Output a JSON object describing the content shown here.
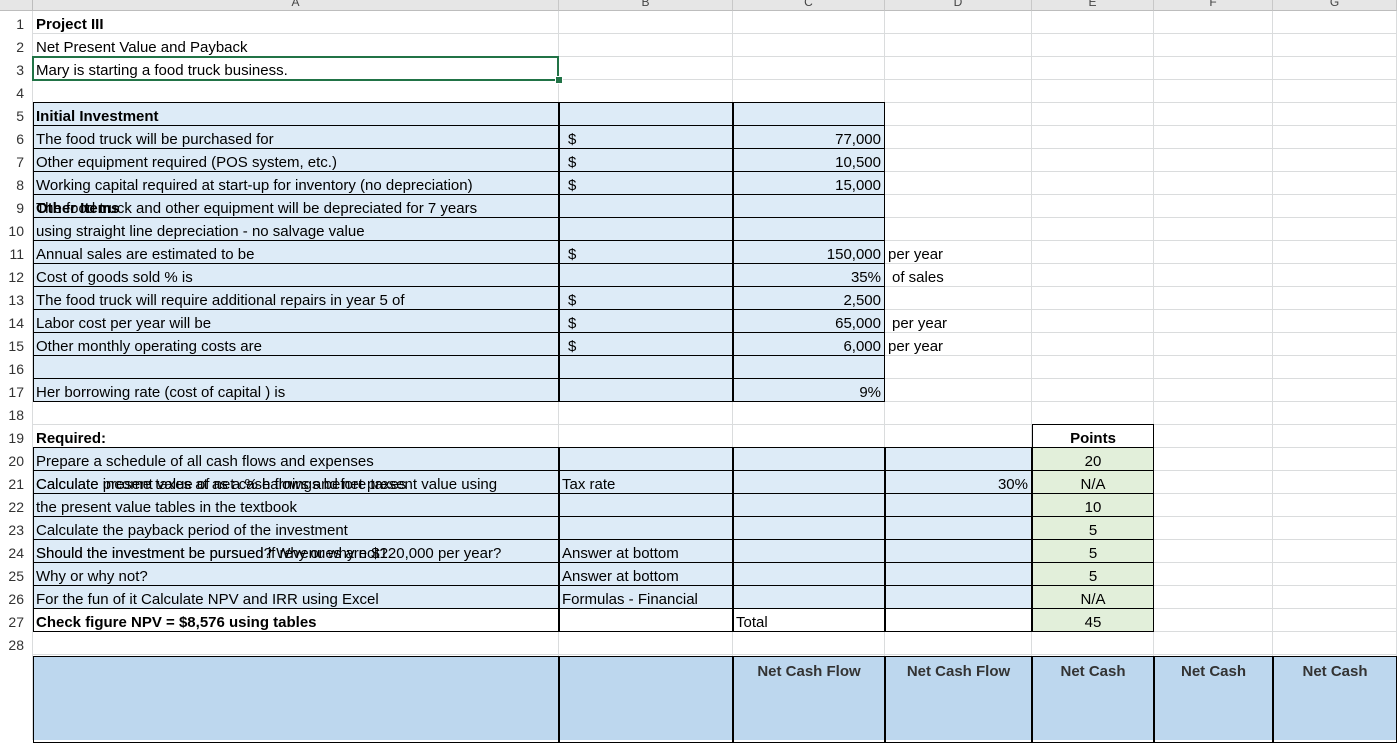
{
  "columns": [
    {
      "letter": "A"
    },
    {
      "letter": "B"
    },
    {
      "letter": "C"
    },
    {
      "letter": "D"
    },
    {
      "letter": "E"
    },
    {
      "letter": "F"
    },
    {
      "letter": "G"
    }
  ],
  "row_numbers": [
    "1",
    "2",
    "3",
    "4",
    "5",
    "6",
    "7",
    "8",
    "9",
    "10",
    "11",
    "12",
    "13",
    "14",
    "15",
    "16",
    "17",
    "18",
    "19",
    "20",
    "21",
    "22",
    "23",
    "24",
    "25",
    "26",
    "27",
    "28"
  ],
  "cells": {
    "r1": {
      "a": "Project III"
    },
    "r2": {
      "a": "Net Present Value and Payback"
    },
    "r3": {
      "a": "Mary is starting a food truck business."
    },
    "r5": {
      "a": "Initial Investment"
    },
    "r6": {
      "a": "The food truck will be purchased for",
      "b": "$",
      "c": "77,000"
    },
    "r7": {
      "a": "Other equipment required (POS system, etc.)",
      "b": "$",
      "c": "10,500"
    },
    "r8": {
      "a": "Working capital required at start-up for inventory (no depreciation)",
      "b": "$",
      "c": "15,000"
    },
    "r9": {
      "a": "Other Items"
    },
    "r10": {
      "a1": "The food truck and other equipment will be depreciated for 7 years",
      "a2": "using straight line depreciation  - no salvage value"
    },
    "r11": {
      "a": "Annual sales are estimated to be",
      "b": "$",
      "c": "150,000",
      "d": "per year"
    },
    "r12": {
      "a": "Cost of goods sold % is",
      "c": "35%",
      "d": "of sales"
    },
    "r13": {
      "a": "The food truck will require additional repairs in year 5 of",
      "b": "$",
      "c": "2,500"
    },
    "r14": {
      "a": "Labor cost per year will be",
      "b": "$",
      "c": "65,000",
      "d": "per year"
    },
    "r15": {
      "a": "Other monthly operating costs are",
      "b": "$",
      "c": "6,000",
      "d": "per year"
    },
    "r17": {
      "a": "Her borrowing rate (cost of capital ) is",
      "c": "9%"
    },
    "r19": {
      "a": "Required:",
      "e": "Points"
    },
    "r20": {
      "a": "Prepare a schedule of all cash flows and expenses",
      "e": "20"
    },
    "r21": {
      "a": "Calculate income taxes at as a % earnings before taxes",
      "b": "Tax rate",
      "d": "30%",
      "e": "N/A"
    },
    "r22": {
      "a1": "Calculate present value  of net cash flows and net present value using",
      "a2": "the present value tables in the textbook",
      "e": "10"
    },
    "r23": {
      "a": "Calculate the payback period of the investment",
      "e": "5"
    },
    "r24": {
      "a": "Should the investment be pursued? Why or why not?",
      "b": "Answer at bottom",
      "e": "5"
    },
    "r25": {
      "a1": "Should the investment be pursued if revenues are $120,000 per year?",
      "a2": "Why or why not?",
      "b": "Answer at bottom",
      "e": "5"
    },
    "r26": {
      "a": "For the fun of it Calculate NPV and IRR using Excel",
      "b": "Formulas - Financial",
      "e": "N/A"
    },
    "r27": {
      "a": "Check figure NPV = $8,576 using tables",
      "c": "Total",
      "e": "45"
    },
    "r29": {
      "c": "Net Cash Flow",
      "d": "Net Cash Flow",
      "e": "Net Cash",
      "f": "Net Cash",
      "g": "Net Cash"
    }
  }
}
